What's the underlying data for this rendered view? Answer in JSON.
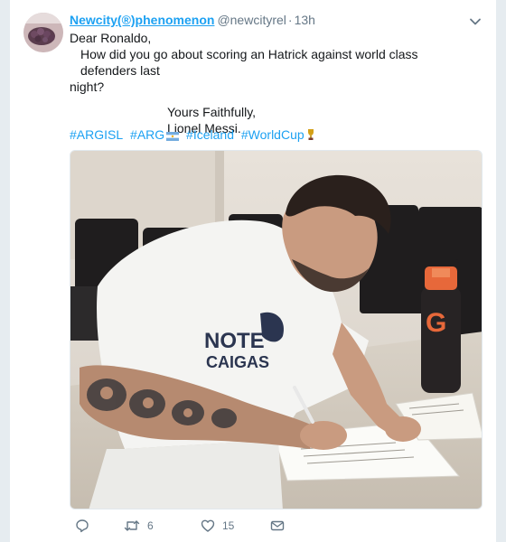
{
  "tweet": {
    "author_name": "Newcity(®)phenomenon",
    "author_handle": "@newcityrel",
    "separator": "·",
    "timestamp": "13h",
    "lines": [
      "Dear Ronaldo,",
      "How did you go about scoring an Hatrick against world class defenders last",
      "night?",
      "Yours Faithfully,",
      "Lionel Messi."
    ],
    "hashtags": [
      "#ARGISL",
      "#ARG",
      "#Iceland",
      "#WorldCup"
    ]
  },
  "photo": {
    "shirt_text_line1": "NOTE",
    "shirt_text_line2": "CAIGAS",
    "bottle_letter": "G"
  },
  "actions": {
    "reply_count": "",
    "retweet_count": "6",
    "like_count": "15"
  },
  "colors": {
    "link": "#1da1f2",
    "muted": "#657786",
    "text": "#14171a",
    "background": "#e6ecf0"
  },
  "icons": {
    "caret": "chevron-down-icon",
    "reply": "reply-icon",
    "retweet": "retweet-icon",
    "like": "heart-icon",
    "dm": "envelope-icon",
    "argentina_flag": "argentina-flag-icon",
    "trophy": "trophy-icon"
  }
}
